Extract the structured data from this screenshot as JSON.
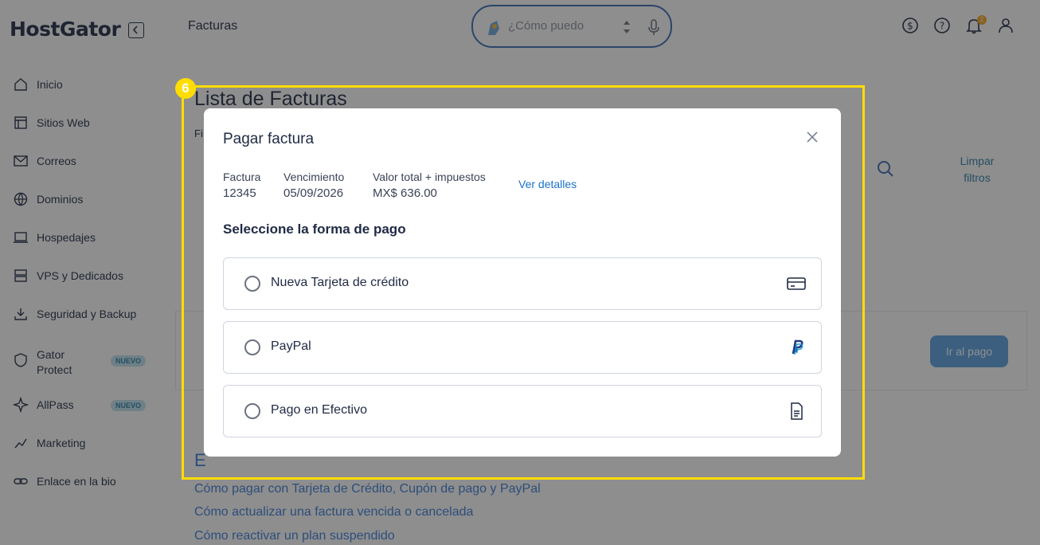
{
  "header": {
    "logo": "HostGator",
    "page_title": "Facturas",
    "search_placeholder": "¿Cómo puedo",
    "notification_count": "2"
  },
  "sidebar": {
    "items": [
      {
        "label": "Inicio",
        "icon": "home-icon"
      },
      {
        "label": "Sitios Web",
        "icon": "layout-icon"
      },
      {
        "label": "Correos",
        "icon": "mail-icon"
      },
      {
        "label": "Dominios",
        "icon": "globe-icon"
      },
      {
        "label": "Hospedajes",
        "icon": "laptop-icon"
      },
      {
        "label": "VPS y Dedicados",
        "icon": "server-icon"
      },
      {
        "label": "Seguridad y Backup",
        "icon": "download-icon"
      },
      {
        "label": "Gator Protect",
        "icon": "shield-icon",
        "badge": "NUEVO"
      },
      {
        "label": "AllPass",
        "icon": "sparkle-icon",
        "badge": "NUEVO"
      },
      {
        "label": "Marketing",
        "icon": "marketing-icon"
      },
      {
        "label": "Enlace en la bio",
        "icon": "link-icon"
      }
    ]
  },
  "main": {
    "title": "Lista de Facturas",
    "filter_label": "Fi",
    "clear_filters": "Limpar filtros",
    "pay_button": "Ir al pago",
    "section_letter": "E",
    "help_links": [
      "Cómo pagar con Tarjeta de Crédito, Cupón de pago y PayPal",
      "Cómo actualizar una factura vencida o cancelada",
      "Cómo reactivar un plan suspendido"
    ]
  },
  "annotation": {
    "step": "6",
    "color": "#ffdd00"
  },
  "modal": {
    "title": "Pagar factura",
    "invoice_label": "Factura",
    "invoice_value": "12345",
    "due_label": "Vencimiento",
    "due_value": "05/09/2026",
    "total_label": "Valor total + impuestos",
    "total_value": "MX$ 636.00",
    "details_link": "Ver detalles",
    "section_heading": "Seleccione la forma de pago",
    "options": [
      {
        "label": "Nueva Tarjeta de crédito",
        "icon": "credit-card-icon"
      },
      {
        "label": "PayPal",
        "icon": "paypal-icon"
      },
      {
        "label": "Pago en Efectivo",
        "icon": "document-icon"
      }
    ]
  },
  "colors": {
    "brand": "#1f2a44",
    "link": "#1a73c8",
    "accent_blue": "#3b6cb5"
  }
}
